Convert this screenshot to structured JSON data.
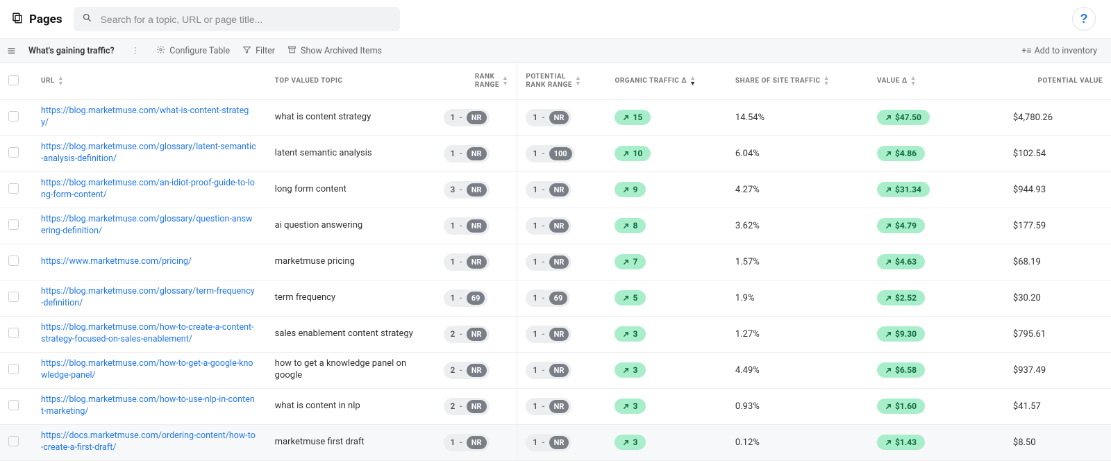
{
  "header": {
    "title": "Pages",
    "search_placeholder": "Search for a topic, URL or page title...",
    "help_label": "?"
  },
  "toolbar": {
    "view_name": "What's gaining traffic?",
    "configure": "Configure Table",
    "filter": "Filter",
    "show_archived": "Show Archived Items",
    "add_inventory": "Add to inventory"
  },
  "columns": {
    "url": "URL",
    "topic": "TOP VALUED TOPIC",
    "rank_range_l1": "RANK",
    "rank_range_l2": "RANGE",
    "potential_rank_l1": "POTENTIAL",
    "potential_rank_l2": "RANK RANGE",
    "organic_traffic": "ORGANIC TRAFFIC Δ",
    "share": "SHARE OF SITE TRAFFIC",
    "value": "VALUE Δ",
    "potential_value": "POTENTIAL VALUE"
  },
  "badges": {
    "nr": "NR"
  },
  "rows": [
    {
      "url": "https://blog.marketmuse.com/what-is-content-strategy/",
      "topic": "what is content strategy",
      "rank_low": "1",
      "rank_high": "NR",
      "prank_low": "1",
      "prank_high": "NR",
      "traffic_delta": "15",
      "share": "14.54%",
      "value_delta": "$47.50",
      "potential_value": "$4,780.26"
    },
    {
      "url": "https://blog.marketmuse.com/glossary/latent-semantic-analysis-definition/",
      "topic": "latent semantic analysis",
      "rank_low": "1",
      "rank_high": "NR",
      "prank_low": "1",
      "prank_high": "100",
      "traffic_delta": "10",
      "share": "6.04%",
      "value_delta": "$4.86",
      "potential_value": "$102.54"
    },
    {
      "url": "https://blog.marketmuse.com/an-idiot-proof-guide-to-long-form-content/",
      "topic": "long form content",
      "rank_low": "3",
      "rank_high": "NR",
      "prank_low": "1",
      "prank_high": "NR",
      "traffic_delta": "9",
      "share": "4.27%",
      "value_delta": "$31.34",
      "potential_value": "$944.93"
    },
    {
      "url": "https://blog.marketmuse.com/glossary/question-answering-definition/",
      "topic": "ai question answering",
      "rank_low": "1",
      "rank_high": "NR",
      "prank_low": "1",
      "prank_high": "NR",
      "traffic_delta": "8",
      "share": "3.62%",
      "value_delta": "$4.79",
      "potential_value": "$177.59"
    },
    {
      "url": "https://www.marketmuse.com/pricing/",
      "topic": "marketmuse pricing",
      "rank_low": "1",
      "rank_high": "NR",
      "prank_low": "1",
      "prank_high": "NR",
      "traffic_delta": "7",
      "share": "1.57%",
      "value_delta": "$4.63",
      "potential_value": "$68.19"
    },
    {
      "url": "https://blog.marketmuse.com/glossary/term-frequency-definition/",
      "topic": "term frequency",
      "rank_low": "1",
      "rank_high": "69",
      "prank_low": "1",
      "prank_high": "69",
      "traffic_delta": "5",
      "share": "1.9%",
      "value_delta": "$2.52",
      "potential_value": "$30.20"
    },
    {
      "url": "https://blog.marketmuse.com/how-to-create-a-content-strategy-focused-on-sales-enablement/",
      "topic": "sales enablement content strategy",
      "rank_low": "2",
      "rank_high": "NR",
      "prank_low": "1",
      "prank_high": "NR",
      "traffic_delta": "3",
      "share": "1.27%",
      "value_delta": "$9.30",
      "potential_value": "$795.61"
    },
    {
      "url": "https://blog.marketmuse.com/how-to-get-a-google-knowledge-panel/",
      "topic": "how to get a knowledge panel on google",
      "rank_low": "2",
      "rank_high": "NR",
      "prank_low": "1",
      "prank_high": "NR",
      "traffic_delta": "3",
      "share": "4.49%",
      "value_delta": "$6.58",
      "potential_value": "$937.49"
    },
    {
      "url": "https://blog.marketmuse.com/how-to-use-nlp-in-content-marketing/",
      "topic": "what is content in nlp",
      "rank_low": "2",
      "rank_high": "NR",
      "prank_low": "1",
      "prank_high": "NR",
      "traffic_delta": "3",
      "share": "0.93%",
      "value_delta": "$1.60",
      "potential_value": "$41.57"
    },
    {
      "url": "https://docs.marketmuse.com/ordering-content/how-to-create-a-first-draft/",
      "topic": "marketmuse first draft",
      "rank_low": "1",
      "rank_high": "NR",
      "prank_low": "1",
      "prank_high": "NR",
      "traffic_delta": "3",
      "share": "0.12%",
      "value_delta": "$1.43",
      "potential_value": "$8.50"
    }
  ]
}
